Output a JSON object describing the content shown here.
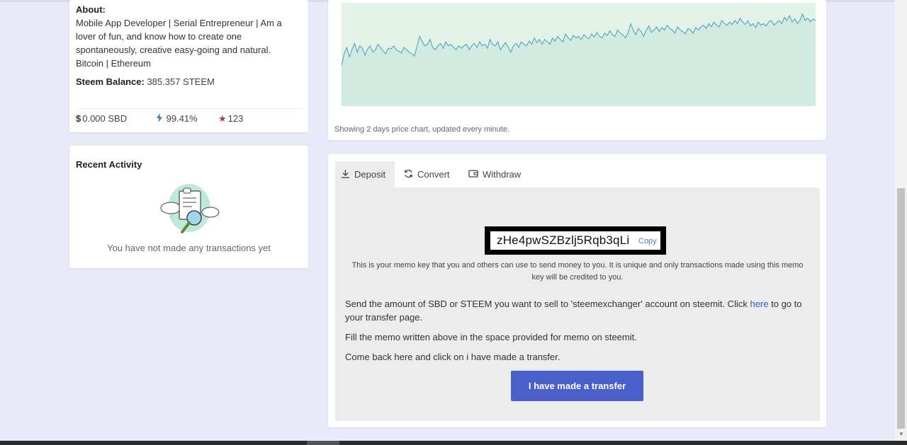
{
  "profile": {
    "about_label": "About:",
    "about_text": "Mobile App Developer | Serial Entrepreneur | Am a lover of fun, and know how to create one spontaneously, creative easy-going and natural. Bitcoin | Ethereum",
    "balance_label": "Steem Balance:",
    "balance_value": "385.357 STEEM",
    "sbd_symbol": "$",
    "sbd": "0.000 SBD",
    "voting_power": "99.41%",
    "reputation": "123",
    "colors": {
      "sbd_icon": "#333333",
      "power_icon": "#2c7cc4",
      "star_icon": "#b03a3a"
    }
  },
  "recent_activity": {
    "title": "Recent Activity",
    "empty_text": "You have not made any transactions yet",
    "illustration": "document-search-icon"
  },
  "chart": {
    "note": "Showing 2 days price chart, updated every minute.",
    "colors": {
      "line": "#4a9bc0",
      "fill": "#d2ebe0",
      "bg": "#e2f2e6"
    }
  },
  "chart_data": {
    "type": "area",
    "values": [
      0.35,
      0.5,
      0.58,
      0.46,
      0.55,
      0.63,
      0.52,
      0.6,
      0.57,
      0.48,
      0.56,
      0.6,
      0.52,
      0.55,
      0.62,
      0.58,
      0.53,
      0.5,
      0.57,
      0.56,
      0.6,
      0.55,
      0.53,
      0.51,
      0.58,
      0.55,
      0.52,
      0.5,
      0.47,
      0.6,
      0.72,
      0.65,
      0.6,
      0.62,
      0.68,
      0.58,
      0.55,
      0.6,
      0.63,
      0.57,
      0.65,
      0.6,
      0.62,
      0.58,
      0.55,
      0.6,
      0.57,
      0.6,
      0.62,
      0.55,
      0.6,
      0.63,
      0.58,
      0.65,
      0.6,
      0.62,
      0.57,
      0.68,
      0.62,
      0.6,
      0.65,
      0.55,
      0.6,
      0.64,
      0.58,
      0.52,
      0.6,
      0.63,
      0.58,
      0.65,
      0.62,
      0.6,
      0.66,
      0.62,
      0.7,
      0.64,
      0.68,
      0.62,
      0.68,
      0.65,
      0.62,
      0.7,
      0.66,
      0.72,
      0.68,
      0.65,
      0.75,
      0.7,
      0.67,
      0.73,
      0.7,
      0.72,
      0.68,
      0.74,
      0.71,
      0.69,
      0.75,
      0.71,
      0.77,
      0.72,
      0.7,
      0.76,
      0.73,
      0.79,
      0.74,
      0.72,
      0.8,
      0.76,
      0.74,
      0.7,
      0.76,
      0.88,
      0.8,
      0.74,
      0.82,
      0.78,
      0.72,
      0.8,
      0.85,
      0.77,
      0.8,
      0.84,
      0.78,
      0.83,
      0.8,
      0.86,
      0.82,
      0.8,
      0.76,
      0.84,
      0.8,
      0.78,
      0.75,
      0.82,
      0.8,
      0.76,
      0.83,
      0.8,
      0.84,
      0.86,
      0.82,
      0.88,
      0.84,
      0.9,
      0.86,
      0.84,
      0.92,
      0.88,
      0.86,
      0.9,
      0.87,
      0.92,
      0.88,
      0.95,
      0.9,
      0.87,
      0.92,
      0.85,
      0.88,
      0.83,
      0.9,
      0.86,
      0.88,
      0.85,
      0.9,
      0.92,
      0.86,
      0.89,
      0.92,
      0.88,
      0.96,
      0.92,
      0.98,
      0.9,
      0.94,
      0.88,
      0.92,
      1.0,
      0.92,
      0.95,
      0.9,
      0.94,
      0.92
    ]
  },
  "tabs": [
    {
      "label": "Deposit",
      "icon": "download-icon",
      "active": true
    },
    {
      "label": "Convert",
      "icon": "refresh-icon",
      "active": false
    },
    {
      "label": "Withdraw",
      "icon": "wallet-icon",
      "active": false
    }
  ],
  "deposit": {
    "memo_key": "zHe4pwSZBzlj5Rqb3qLi",
    "copy_label": "Copy",
    "memo_note": "This is your memo key that you and others can use to send money to you. It is unique and only transactions made using this memo key will be credited to you.",
    "instruction1_before": "Send the amount of SBD or STEEM you want to sell to 'steemexchanger' account on steemit. Click ",
    "instruction1_link": "here",
    "instruction1_after": " to go to your transfer page.",
    "instruction2": "Fill the memo written above in the space provided for memo on steemit.",
    "instruction3": "Come back here and click on i have made a transfer.",
    "button_label": "I have made a transfer",
    "colors": {
      "button": "#4a5fc9",
      "panel": "#ececec",
      "link": "#2c5dc2"
    }
  }
}
